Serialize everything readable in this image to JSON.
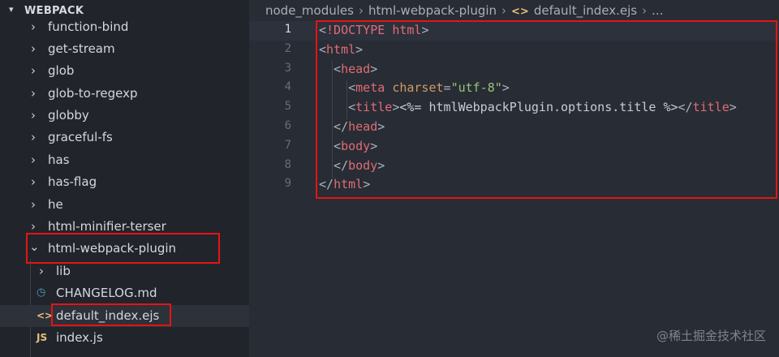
{
  "sidebar": {
    "title": "WEBPACK",
    "items": [
      {
        "label": "function-bind",
        "type": "folder",
        "expanded": false
      },
      {
        "label": "get-stream",
        "type": "folder",
        "expanded": false
      },
      {
        "label": "glob",
        "type": "folder",
        "expanded": false
      },
      {
        "label": "glob-to-regexp",
        "type": "folder",
        "expanded": false
      },
      {
        "label": "globby",
        "type": "folder",
        "expanded": false
      },
      {
        "label": "graceful-fs",
        "type": "folder",
        "expanded": false
      },
      {
        "label": "has",
        "type": "folder",
        "expanded": false
      },
      {
        "label": "has-flag",
        "type": "folder",
        "expanded": false
      },
      {
        "label": "he",
        "type": "folder",
        "expanded": false
      },
      {
        "label": "html-minifier-terser",
        "type": "folder",
        "expanded": false
      },
      {
        "label": "html-webpack-plugin",
        "type": "folder",
        "expanded": true
      },
      {
        "label": "lib",
        "type": "folder",
        "expanded": false
      },
      {
        "label": "CHANGELOG.md",
        "type": "file",
        "icon": "info-icon"
      },
      {
        "label": "default_index.ejs",
        "type": "file",
        "icon": "ejs-icon",
        "selected": true
      },
      {
        "label": "index.js",
        "type": "file",
        "icon": "js-icon"
      }
    ]
  },
  "breadcrumb": {
    "part1": "node_modules",
    "part2": "html-webpack-plugin",
    "part3": "default_index.ejs",
    "ellipsis": "..."
  },
  "editor": {
    "active_line": 1,
    "lines": [
      {
        "num": "1",
        "tokens": [
          [
            "punct",
            "<"
          ],
          [
            "tag",
            "!DOCTYPE"
          ],
          [
            "punct",
            " "
          ],
          [
            "tag",
            "html"
          ],
          [
            "punct",
            ">"
          ]
        ]
      },
      {
        "num": "2",
        "tokens": [
          [
            "punct",
            "<"
          ],
          [
            "tag",
            "html"
          ],
          [
            "punct",
            ">"
          ]
        ]
      },
      {
        "num": "3",
        "tokens": [
          [
            "punct",
            "  <"
          ],
          [
            "tag",
            "head"
          ],
          [
            "punct",
            ">"
          ]
        ]
      },
      {
        "num": "4",
        "tokens": [
          [
            "punct",
            "    <"
          ],
          [
            "tag",
            "meta"
          ],
          [
            "punct",
            " "
          ],
          [
            "attr",
            "charset"
          ],
          [
            "punct",
            "="
          ],
          [
            "str",
            "\"utf-8\""
          ],
          [
            "punct",
            ">"
          ]
        ]
      },
      {
        "num": "5",
        "tokens": [
          [
            "punct",
            "    <"
          ],
          [
            "tag",
            "title"
          ],
          [
            "punct",
            ">"
          ],
          [
            "ejs",
            "<%= htmlWebpackPlugin.options.title %>"
          ],
          [
            "punct",
            "</"
          ],
          [
            "tag",
            "title"
          ],
          [
            "punct",
            ">"
          ]
        ]
      },
      {
        "num": "6",
        "tokens": [
          [
            "punct",
            "  </"
          ],
          [
            "tag",
            "head"
          ],
          [
            "punct",
            ">"
          ]
        ]
      },
      {
        "num": "7",
        "tokens": [
          [
            "punct",
            "  <"
          ],
          [
            "tag",
            "body"
          ],
          [
            "punct",
            ">"
          ]
        ]
      },
      {
        "num": "8",
        "tokens": [
          [
            "punct",
            "  </"
          ],
          [
            "tag",
            "body"
          ],
          [
            "punct",
            ">"
          ]
        ]
      },
      {
        "num": "9",
        "tokens": [
          [
            "punct",
            "</"
          ],
          [
            "tag",
            "html"
          ],
          [
            "punct",
            ">"
          ]
        ]
      }
    ]
  },
  "watermark": "@稀土掘金技术社区",
  "colors": {
    "highlight_box": "#e51414",
    "tag": "#e06c75",
    "string": "#98c379",
    "attribute": "#d19a66"
  }
}
